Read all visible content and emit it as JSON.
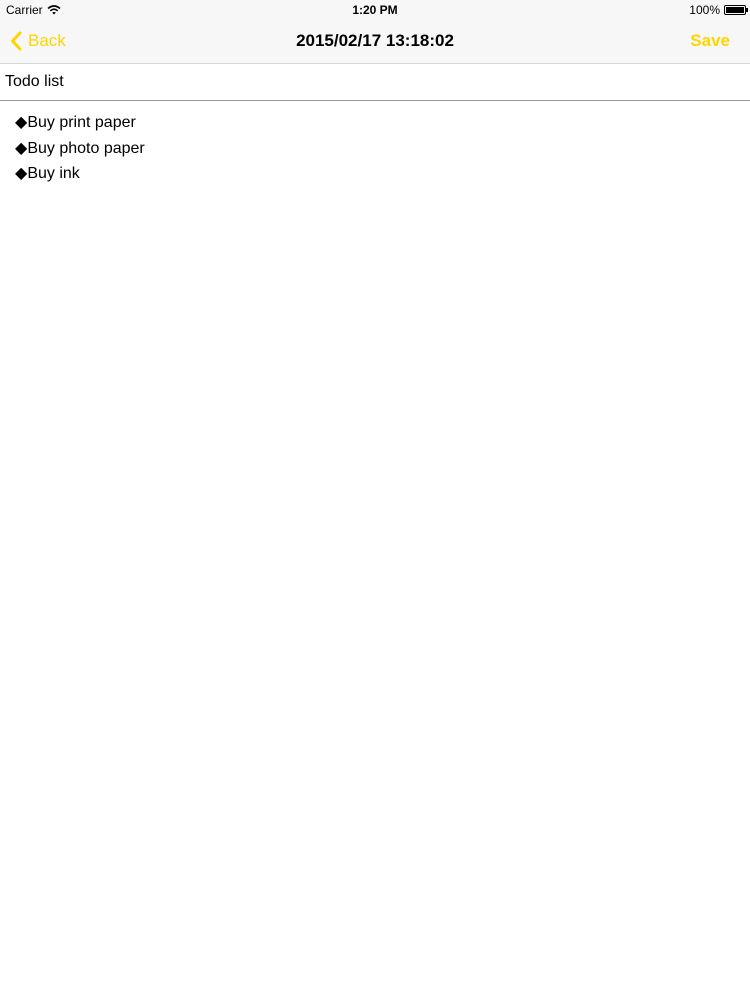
{
  "status_bar": {
    "carrier": "Carrier",
    "time": "1:20 PM",
    "battery_text": "100%",
    "battery_level": 1.0,
    "icons": [
      "wifi-icon",
      "battery-icon"
    ]
  },
  "nav": {
    "back_label": "Back",
    "title": "2015/02/17 13:18:02",
    "save_label": "Save",
    "accent_color": "#ffd500",
    "icons": [
      "chevron-left-icon"
    ]
  },
  "note": {
    "title_value": "Todo list",
    "bullet": "◆",
    "items": [
      "Buy print paper",
      "Buy photo paper",
      "Buy ink"
    ]
  }
}
